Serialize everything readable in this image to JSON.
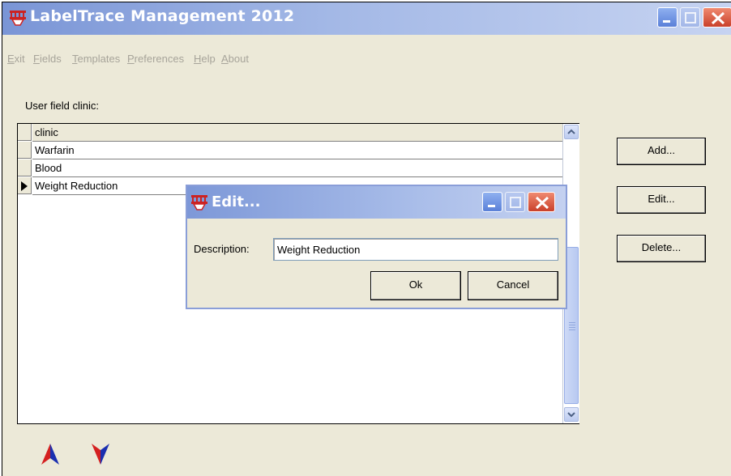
{
  "window": {
    "title": "LabelTrace Management 2012"
  },
  "menu": [
    {
      "label": "Exit"
    },
    {
      "label": "Fields"
    },
    {
      "label": "Templates"
    },
    {
      "label": "Preferences"
    },
    {
      "label": "Help"
    },
    {
      "label": "About"
    }
  ],
  "panel": {
    "label": "User field clinic:"
  },
  "grid": {
    "header": "clinic",
    "rows": [
      {
        "value": "Warfarin"
      },
      {
        "value": "Blood"
      },
      {
        "value": "Weight Reduction",
        "current": true
      }
    ]
  },
  "buttons": {
    "add": "Add...",
    "edit": "Edit...",
    "delete": "Delete..."
  },
  "dialog": {
    "title": "Edit...",
    "description_label": "Description:",
    "description_value": "Weight Reduction",
    "ok": "Ok",
    "cancel": "Cancel"
  },
  "icons": {
    "app": "labeltrace-app-icon",
    "move_up": "move-up-arrow-icon",
    "move_down": "move-down-arrow-icon",
    "row_pointer": "row-pointer-icon"
  },
  "colors": {
    "titlebar_start": "#7a95d6",
    "titlebar_end": "#c6d3f1",
    "face": "#ece9d8",
    "close_button": "#c9402a",
    "arrow_red": "#d42020",
    "arrow_blue": "#1a2fb0"
  }
}
